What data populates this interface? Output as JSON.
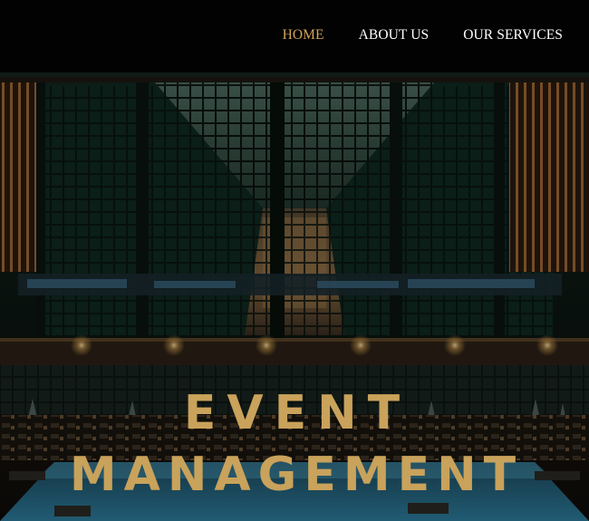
{
  "nav": {
    "items": [
      {
        "label": "HOME",
        "active": true
      },
      {
        "label": "ABOUT US",
        "active": false
      },
      {
        "label": "OUR SERVICES",
        "active": false
      }
    ]
  },
  "hero": {
    "title_line1": "EVENT",
    "title_line2": "MANAGEMENT",
    "image_description_icon": "venue-interior-photo"
  },
  "colors": {
    "accent": "#d4a457",
    "title": "#c9a25b",
    "nav_background": "#020202",
    "nav_text": "#ffffff"
  }
}
